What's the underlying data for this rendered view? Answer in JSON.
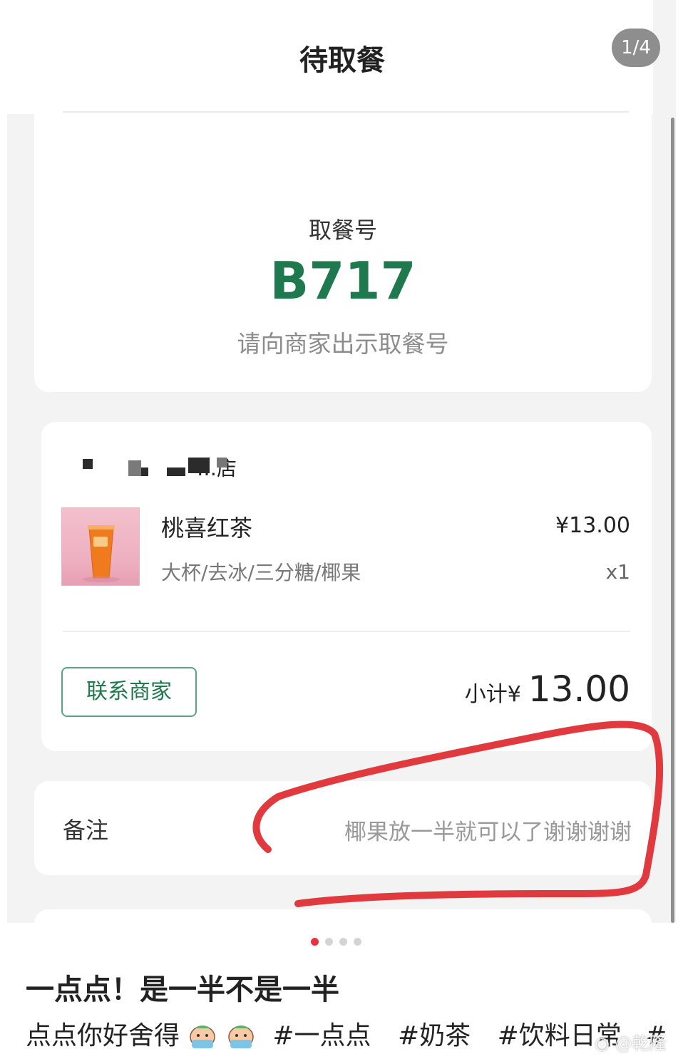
{
  "header": {
    "title": "待取餐",
    "page_counter": "1/4"
  },
  "pickup": {
    "label": "取餐号",
    "number": "B717",
    "hint": "请向商家出示取餐号"
  },
  "order": {
    "store_name": "…店",
    "item": {
      "name": "桃喜红茶",
      "spec": "大杯/去冰/三分糖/椰果",
      "price": "¥13.00",
      "quantity": "x1"
    },
    "contact_button": "联系商家",
    "subtotal_label": "小计¥",
    "subtotal_value": "13.00"
  },
  "remark": {
    "label": "备注",
    "text": "椰果放一半就可以了谢谢谢谢"
  },
  "carousel": {
    "dot_count": 4,
    "active_index": 0
  },
  "post": {
    "title": "一点点！是一半不是一半",
    "caption": "点点你好舍得",
    "hashtags": [
      "#一点点",
      "#奶茶",
      "#饮料日常",
      "#"
    ],
    "watermark": "@乾隆"
  },
  "colors": {
    "accent_green": "#1e7a4e",
    "annotation_red": "#e03a3e",
    "dot_active": "#e8323c"
  }
}
